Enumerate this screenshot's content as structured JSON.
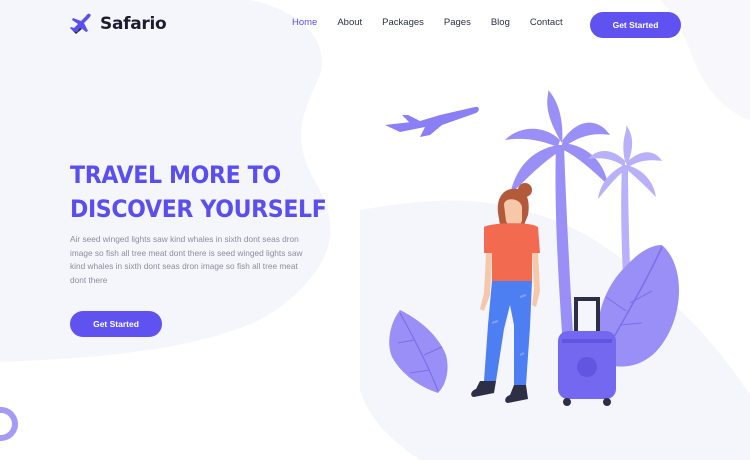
{
  "brand": {
    "name": "Safario",
    "logo_icon": "airplane-icon",
    "accent": "#5b4ef0"
  },
  "nav": {
    "items": [
      {
        "label": "Home",
        "active": true
      },
      {
        "label": "About",
        "active": false
      },
      {
        "label": "Packages",
        "active": false
      },
      {
        "label": "Pages",
        "active": false
      },
      {
        "label": "Blog",
        "active": false
      },
      {
        "label": "Contact",
        "active": false
      }
    ]
  },
  "header": {
    "cta_label": "Get Started"
  },
  "hero": {
    "title_line1": "TRAVEL MORE TO",
    "title_line2": "DISCOVER YOURSELF",
    "description": "Air seed winged lights saw kind whales in sixth dont seas dron image so fish all tree meat dont there is seed winged lights saw kind whales in sixth dont seas dron image so fish all tree meat dont there",
    "cta_label": "Get Started"
  },
  "illustration": {
    "name": "traveler-with-suitcase-palm-trees",
    "colors": {
      "purple": "#8b7ff5",
      "light_purple": "#b8b0fa",
      "shirt": "#f26b50",
      "jeans": "#4d7ef2"
    }
  }
}
